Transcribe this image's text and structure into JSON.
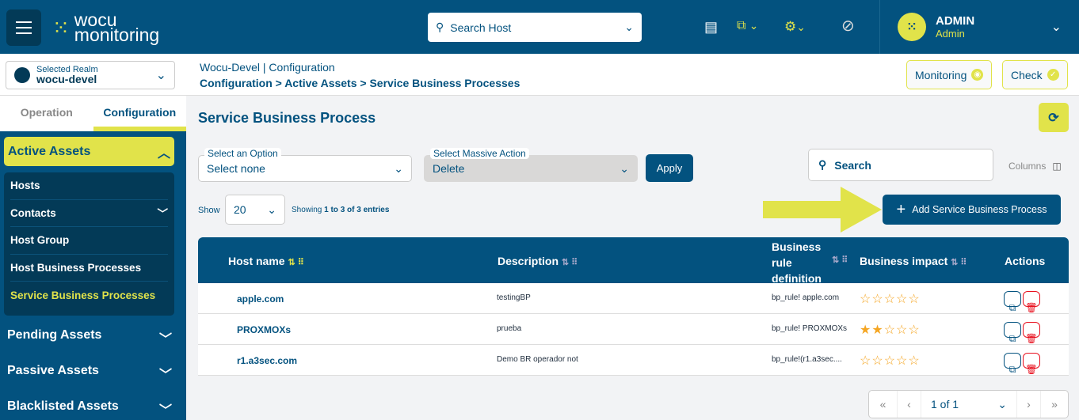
{
  "header": {
    "logo_line1": "wocu",
    "logo_line2": "monitoring",
    "search_placeholder": "Search Host",
    "user_name": "ADMIN",
    "user_role": "Admin",
    "icons": [
      "menu-icon",
      "book-icon",
      "external-link-icon",
      "gears-icon",
      "no-sync-icon",
      "chevron-down-icon"
    ]
  },
  "realm": {
    "label": "Selected Realm",
    "value": "wocu-devel"
  },
  "breadcrumb": {
    "top_realm": "Wocu-Devel",
    "top_section": "Configuration",
    "path": "Configuration > Active Assets > Service Business Processes"
  },
  "top_buttons": {
    "monitoring": "Monitoring",
    "check": "Check"
  },
  "sidebar": {
    "tabs": [
      "Operation",
      "Configuration"
    ],
    "active_tab": "Configuration",
    "active_group": "Active Assets",
    "items": [
      "Hosts",
      "Contacts",
      "Host Group",
      "Host Business Processes",
      "Service Business Processes"
    ],
    "active_item": "Service Business Processes",
    "groups": [
      "Pending Assets",
      "Passive Assets",
      "Blacklisted Assets"
    ]
  },
  "main": {
    "title": "Service Business Process",
    "option_label": "Select an Option",
    "option_value": "Select none",
    "massive_label": "Select Massive Action",
    "massive_value": "Delete",
    "apply": "Apply",
    "search_placeholder": "Search",
    "columns": "Columns",
    "show_label": "Show",
    "show_value": "20",
    "showing_prefix": "Showing",
    "showing_range": "1 to 3 of 3 entries",
    "add_button": "Add Service Business Process"
  },
  "table": {
    "headers": [
      "Host name",
      "Description",
      "Business rule definition",
      "Business impact",
      "Actions"
    ],
    "rows": [
      {
        "host": "apple.com",
        "description": "testingBP",
        "rule": "bp_rule! apple.com",
        "impact": 0
      },
      {
        "host": "PROXMOXs",
        "description": "prueba",
        "rule": "bp_rule! PROXMOXs",
        "impact": 2
      },
      {
        "host": "r1.a3sec.com",
        "description": "Demo BR operador not",
        "rule": "bp_rule!(r1.a3sec....",
        "impact": 0
      }
    ]
  },
  "pagination": {
    "page": "1 of 1"
  },
  "colors": {
    "primary": "#03527f",
    "accent": "#e1e34a",
    "star": "#f5a623",
    "delete": "#e8101e"
  }
}
